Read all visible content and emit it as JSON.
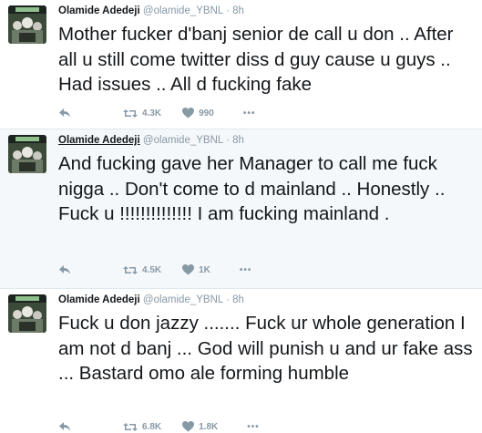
{
  "tweets": [
    {
      "name": "Olamide Adedeji",
      "handle": "@olamide_YBNL",
      "separator": "·",
      "time": "8h",
      "text": "Mother fucker d'banj senior de call u don .. After all u still come twitter diss d guy cause u guys .. Had issues .. All d fucking fake",
      "retweets": "4.3K",
      "likes": "990",
      "more": "•••"
    },
    {
      "name": "Olamide Adedeji",
      "handle": "@olamide_YBNL",
      "separator": "·",
      "time": "8h",
      "text": "And fucking gave her Manager to call me fuck nigga .. Don't come to d mainland .. Honestly .. Fuck u !!!!!!!!!!!!!! I am fucking mainland .",
      "retweets": "4.5K",
      "likes": "1K",
      "more": "•••"
    },
    {
      "name": "Olamide Adedeji",
      "handle": "@olamide_YBNL",
      "separator": "·",
      "time": "8h",
      "text": "Fuck u don jazzy ....... Fuck ur whole generation I am not d banj ... God will punish u and ur fake ass ... Bastard omo ale forming humble",
      "retweets": "6.8K",
      "likes": "1.8K",
      "more": "•••"
    }
  ],
  "colors": {
    "text": "#14171a",
    "muted": "#8899a6",
    "highlight_bg": "#f5f8fa",
    "divider": "#e1e8ed"
  },
  "icons": [
    "avatar",
    "reply-icon",
    "retweet-icon",
    "heart-icon",
    "more-icon"
  ]
}
